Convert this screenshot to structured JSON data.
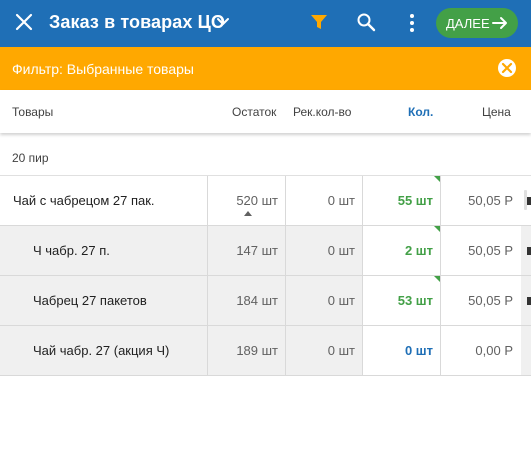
{
  "appbar": {
    "title": "Заказ в товарах ЦО",
    "next_label": "ДАЛЕЕ",
    "accent_color": "#1f6fb6",
    "filter_icon_color": "#ffa800",
    "next_button_color": "#43a047",
    "icons": [
      "close-icon",
      "chevron-down-icon",
      "filter-icon",
      "search-icon",
      "more-vert-icon",
      "arrow-right-icon"
    ]
  },
  "filter_bar": {
    "text": "Фильтр: Выбранные товары",
    "color": "#ffa800"
  },
  "columns": {
    "goods": "Товары",
    "stock": "Остаток",
    "recommended": "Рек.кол-во",
    "quantity": "Кол.",
    "price": "Цена"
  },
  "group": {
    "label": "20 пир"
  },
  "rows": [
    {
      "name": "Чай с чабрецом 27 пак.",
      "stock": "520 шт",
      "recommended": "0 шт",
      "quantity": "55 шт",
      "price": "50,05 Р",
      "quantity_color": "#43a047"
    },
    {
      "name": "Ч чабр. 27 п.",
      "stock": "147 шт",
      "recommended": "0 шт",
      "quantity": "2 шт",
      "price": "50,05 Р",
      "quantity_color": "#43a047"
    },
    {
      "name": "Чабрец 27 пакетов",
      "stock": "184 шт",
      "recommended": "0 шт",
      "quantity": "53 шт",
      "price": "50,05 Р",
      "quantity_color": "#43a047"
    },
    {
      "name": "Чай чабр. 27 (акция Ч)",
      "stock": "189 шт",
      "recommended": "0 шт",
      "quantity": "0 шт",
      "price": "0,00 Р",
      "quantity_color": "#1f6fb6"
    }
  ]
}
